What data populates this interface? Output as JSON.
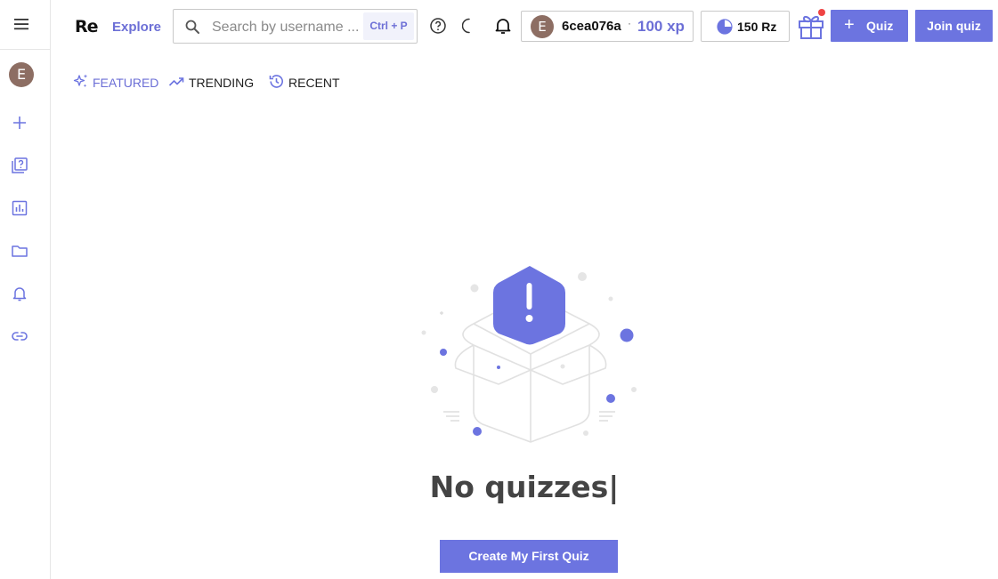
{
  "sidebar": {
    "avatar_initial": "E"
  },
  "header": {
    "logo": "Re",
    "explore_label": "Explore",
    "search": {
      "placeholder": "Search by username ...",
      "shortcut": "Ctrl + P"
    },
    "user": {
      "avatar_initial": "E",
      "name": "6cea076a",
      "separator": "·",
      "xp": "100 xp"
    },
    "currency": "150 Rz",
    "quiz_button": "Quiz",
    "join_button": "Join quiz"
  },
  "tabs": [
    {
      "label": "FEATURED",
      "icon": "sparkles-icon",
      "active": true
    },
    {
      "label": "TRENDING",
      "icon": "trending-up-icon",
      "active": false
    },
    {
      "label": "RECENT",
      "icon": "history-icon",
      "active": false
    }
  ],
  "empty_state": {
    "title": "No quizzes|",
    "cta": "Create My First Quiz"
  },
  "colors": {
    "accent": "#6c74e0",
    "notification": "#ef4444",
    "avatar": "#8d6e63"
  }
}
